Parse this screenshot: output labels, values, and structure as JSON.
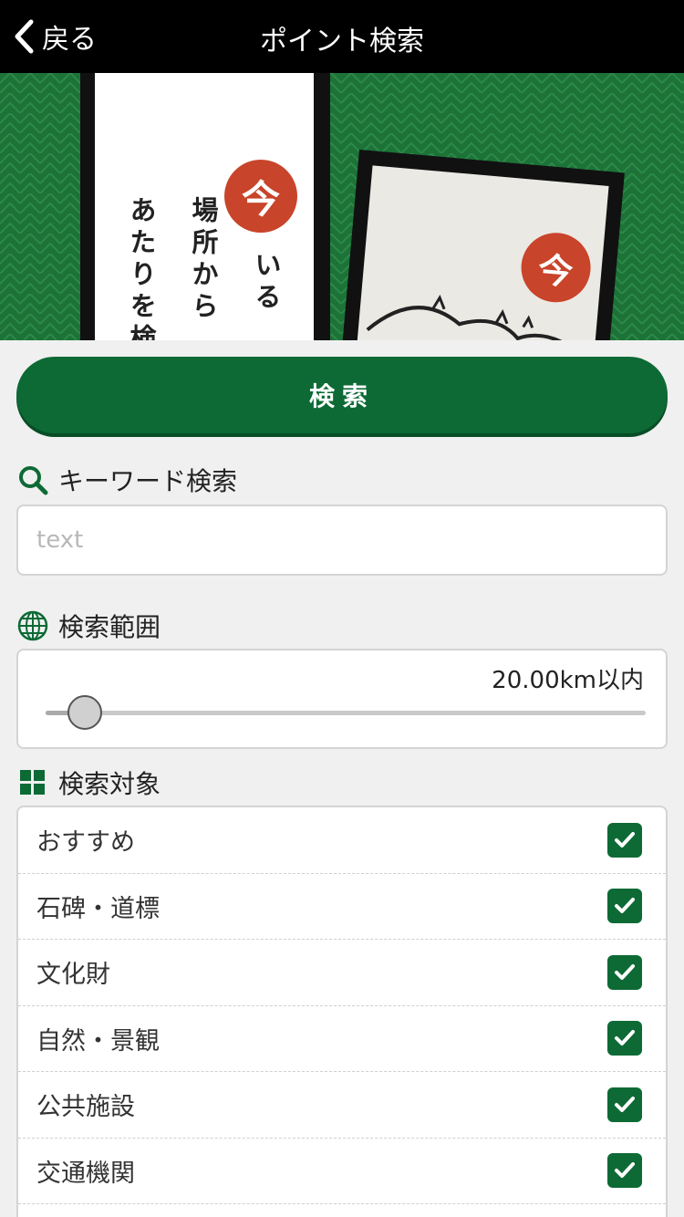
{
  "nav": {
    "back_label": "戻る",
    "title": "ポイント検索"
  },
  "banner": {
    "stamp_char": "今",
    "caption_lines": [
      "いる",
      "場所から",
      "あたりを検索"
    ],
    "card_stamp_char": "今",
    "colors": {
      "background": "#1f7a3b",
      "stamp": "#c8442a"
    }
  },
  "search_button": {
    "label": "検索"
  },
  "keyword": {
    "title": "キーワード検索",
    "placeholder": "text",
    "value": ""
  },
  "range": {
    "title": "検索範囲",
    "value_label": "20.00km以内",
    "slider_fraction": 0.066
  },
  "targets": {
    "title": "検索対象",
    "items": [
      {
        "label": "おすすめ",
        "checked": true
      },
      {
        "label": "石碑・道標",
        "checked": true
      },
      {
        "label": "文化財",
        "checked": true
      },
      {
        "label": "自然・景観",
        "checked": true
      },
      {
        "label": "公共施設",
        "checked": true
      },
      {
        "label": "交通機関",
        "checked": true
      },
      {
        "label": "",
        "checked": true
      }
    ]
  },
  "icons": {
    "back": "chevron-left-icon",
    "keyword": "magnifier-icon",
    "range": "globe-icon",
    "targets": "grid-icon",
    "checkbox": "checkmark-icon"
  },
  "colors": {
    "accent": "#0d6a35",
    "navbar": "#000000"
  }
}
